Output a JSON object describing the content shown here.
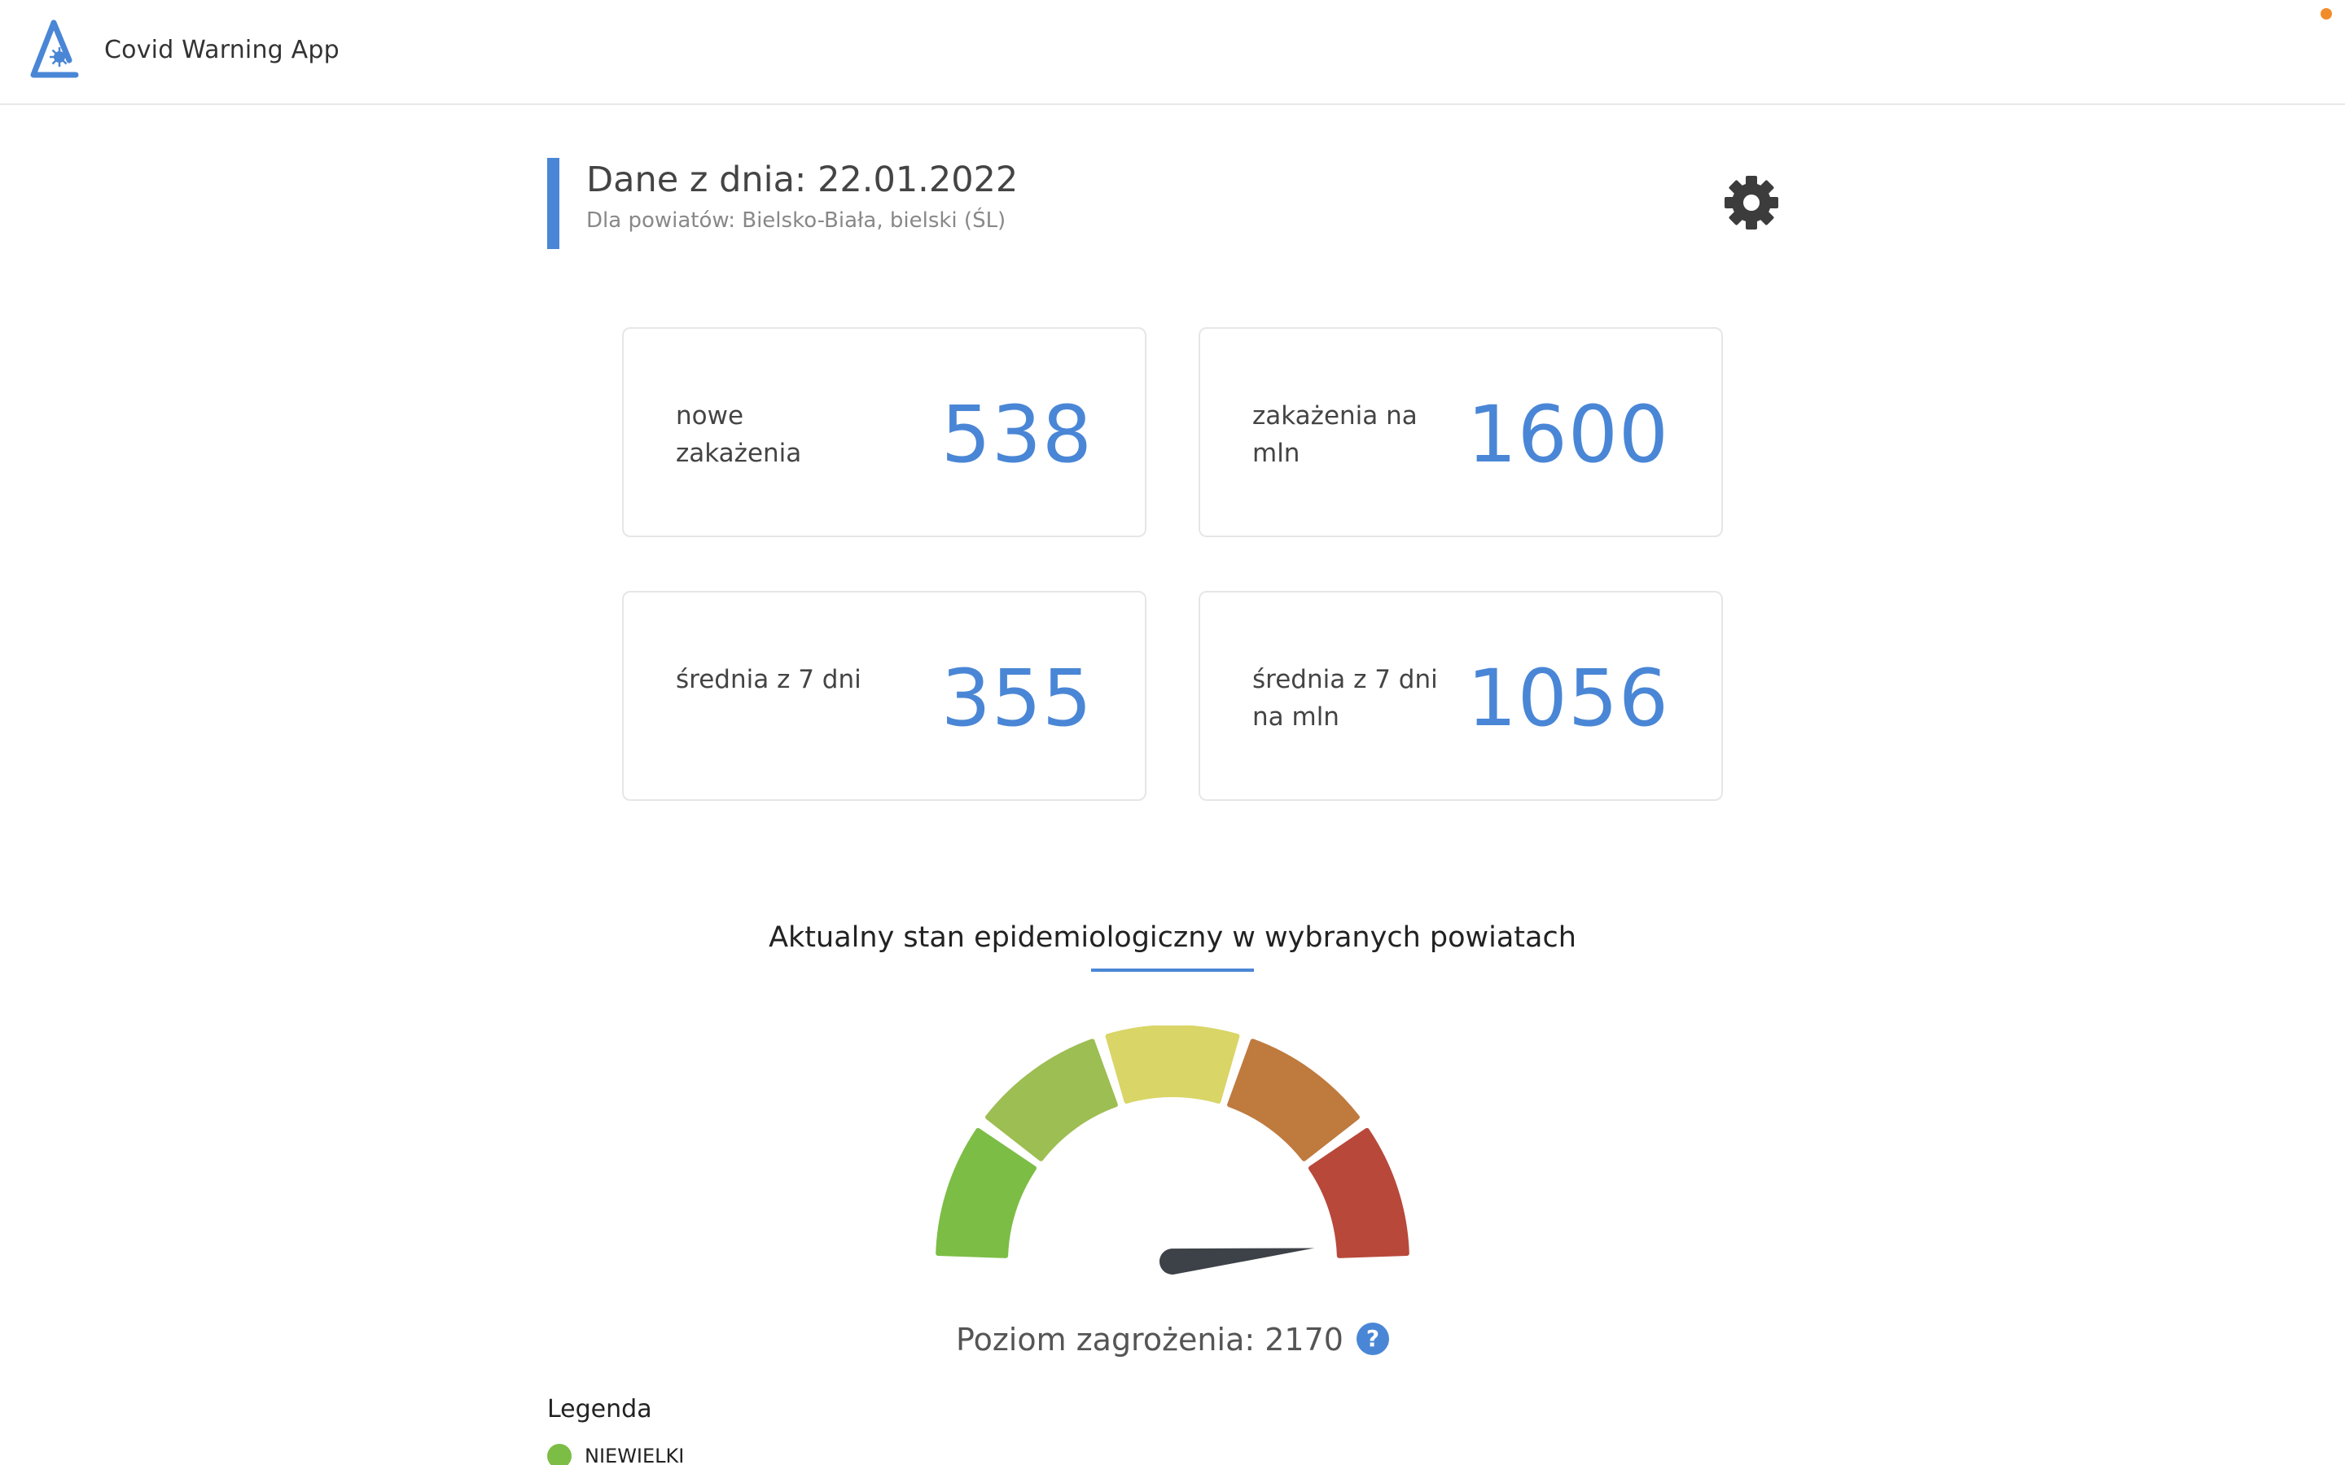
{
  "app": {
    "title": "Covid Warning App",
    "logo_icon": "warning-triangle-virus-icon",
    "accent_color": "#4a86d6"
  },
  "header": {
    "title": "Dane z dnia: 22.01.2022",
    "subtitle": "Dla powiatów: Bielsko-Biała, bielski (ŚL)",
    "settings_icon": "gear-icon"
  },
  "stats": [
    {
      "label": "nowe zakażenia",
      "value": "538"
    },
    {
      "label": "zakażenia na mln",
      "value": "1600"
    },
    {
      "label": "średnia z 7 dni",
      "value": "355"
    },
    {
      "label": "średnia z 7 dni na mln",
      "value": "1056"
    }
  ],
  "section": {
    "title": "Aktualny stan epidemiologiczny w wybranych powiatach"
  },
  "gauge": {
    "segments": [
      {
        "color": "#7cbd45"
      },
      {
        "color": "#9dbe52"
      },
      {
        "color": "#d9d567"
      },
      {
        "color": "#bf7a3e"
      },
      {
        "color": "#b8483a"
      }
    ],
    "needle_fraction": 0.97,
    "needle_color": "#3d4248"
  },
  "level": {
    "label": "Poziom zagrożenia: 2170",
    "help_icon": "?"
  },
  "legend": {
    "title": "Legenda",
    "items": [
      {
        "label": "NIEWIELKI",
        "color": "#7cbd45"
      }
    ]
  }
}
